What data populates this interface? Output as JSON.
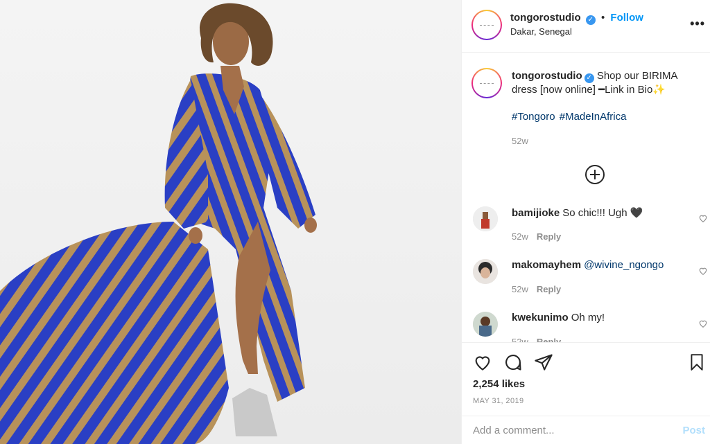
{
  "post": {
    "username": "tongorostudio",
    "follow_label": "Follow",
    "separator": "•",
    "location": "Dakar, Senegal",
    "more_label": "•••",
    "verified_icon": "verified-badge-icon"
  },
  "caption": {
    "username": "tongorostudio",
    "text": "Shop our BIRIMA dress [now online] ━Link in Bio✨",
    "hashtags": [
      "#Tongoro",
      "#MadeInAfrica"
    ],
    "timestamp": "52w"
  },
  "comments": [
    {
      "username": "bamijioke",
      "text": "So chic!!! Ugh 🖤",
      "mention": "",
      "time": "52w",
      "reply_label": "Reply"
    },
    {
      "username": "makomayhem",
      "text": "",
      "mention": "@wivine_ngongo",
      "time": "52w",
      "reply_label": "Reply"
    },
    {
      "username": "kwekunimo",
      "text": "Oh my!",
      "mention": "",
      "time": "52w",
      "reply_label": "Reply"
    }
  ],
  "actions": {
    "likes": "2,254 likes",
    "date": "MAY 31, 2019"
  },
  "add_comment": {
    "placeholder": "Add a comment...",
    "post_label": "Post"
  },
  "colors": {
    "link_blue": "#0095f6",
    "hashtag_blue": "#00376b",
    "muted": "#8e8e8e",
    "dress_blue": "#2a3fc4",
    "dress_tan": "#b8925a"
  }
}
